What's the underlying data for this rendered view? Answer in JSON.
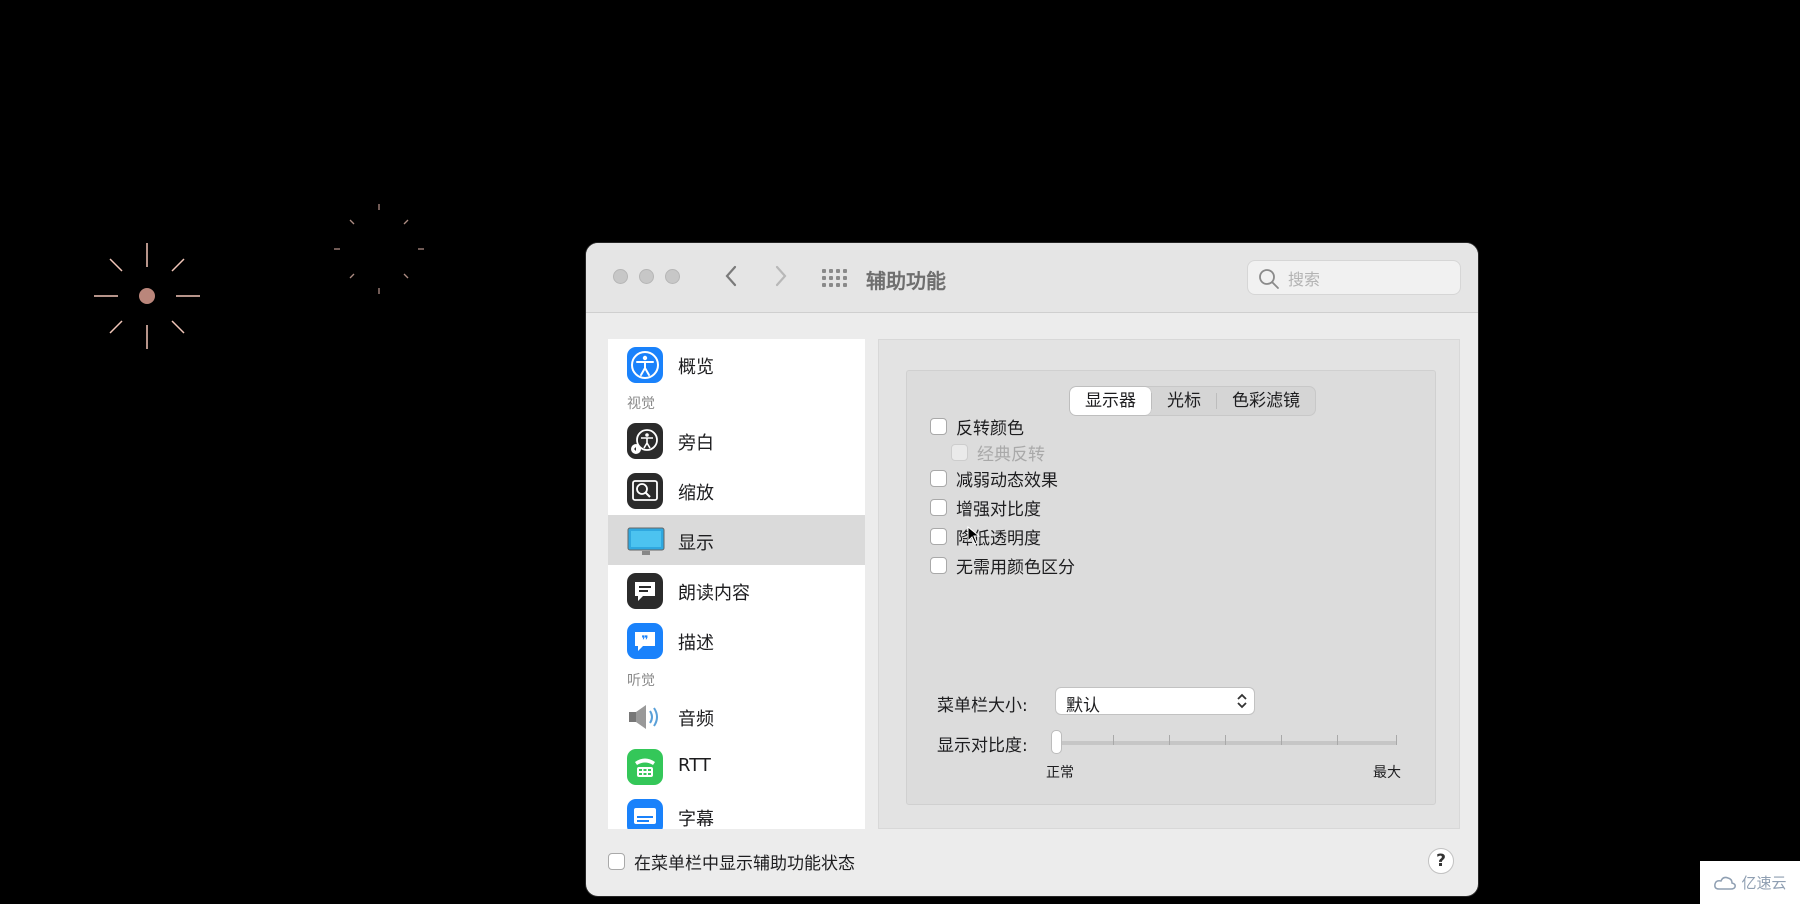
{
  "window": {
    "title": "辅助功能",
    "search_placeholder": "搜索"
  },
  "sidebar": {
    "items": [
      {
        "label": "概览"
      },
      {
        "section": "视觉"
      },
      {
        "label": "旁白"
      },
      {
        "label": "缩放"
      },
      {
        "label": "显示",
        "selected": true
      },
      {
        "label": "朗读内容"
      },
      {
        "label": "描述"
      },
      {
        "section": "听觉"
      },
      {
        "label": "音频"
      },
      {
        "label": "RTT"
      },
      {
        "label": "字幕"
      }
    ]
  },
  "tabs": [
    "显示器",
    "光标",
    "色彩滤镜"
  ],
  "active_tab": "显示器",
  "options": [
    {
      "label": "反转颜色",
      "checked": false
    },
    {
      "label": "经典反转",
      "checked": false,
      "disabled": true
    },
    {
      "label": "减弱动态效果",
      "checked": false
    },
    {
      "label": "增强对比度",
      "checked": false
    },
    {
      "label": "降低透明度",
      "checked": false
    },
    {
      "label": "无需用颜色区分",
      "checked": false
    }
  ],
  "menubar_size": {
    "label": "菜单栏大小:",
    "value": "默认"
  },
  "contrast": {
    "label": "显示对比度:",
    "min_label": "正常",
    "max_label": "最大",
    "value": 0
  },
  "footer": {
    "show_status_label": "在菜单栏中显示辅助功能状态",
    "help": "?"
  },
  "watermark": "亿速云",
  "colors": {
    "accent": "#1a82fb",
    "selected_row": "#dadada"
  }
}
